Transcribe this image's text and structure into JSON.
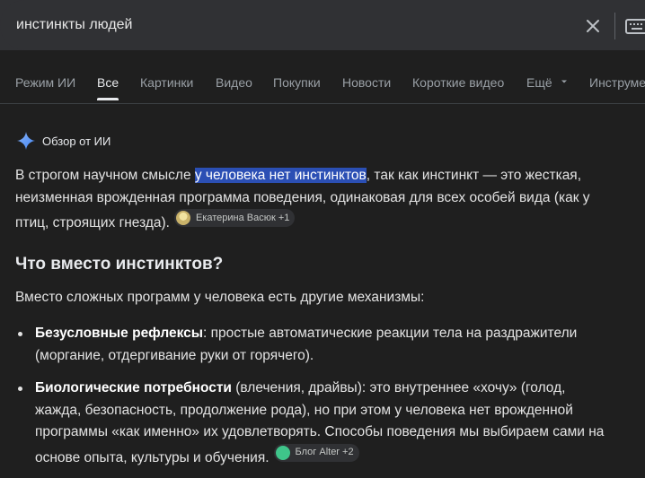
{
  "search": {
    "query": "инстинкты людей"
  },
  "tabs": [
    {
      "label": "Режим ИИ"
    },
    {
      "label": "Все"
    },
    {
      "label": "Картинки"
    },
    {
      "label": "Видео"
    },
    {
      "label": "Покупки"
    },
    {
      "label": "Новости"
    },
    {
      "label": "Короткие видео"
    },
    {
      "label": "Ещё"
    },
    {
      "label": "Инструменты"
    }
  ],
  "overview": {
    "title": "Обзор от ИИ",
    "intro_before": "В строгом научном смысле ",
    "intro_highlight": "у человека нет инстинктов",
    "intro_after": ", так как инстинкт — это жесткая, неизменная врожденная программа поведения, одинаковая для всех особей вида (как у птиц, строящих гнезда).",
    "chip1": "Екатерина Васюк +1",
    "heading": "Что вместо инстинктов?",
    "lead": "Вместо сложных программ у человека есть другие механизмы:",
    "bullet1_bold": "Безусловные рефлексы",
    "bullet1_text": ": простые автоматические реакции тела на раздражители (моргание, отдергивание руки от горячего).",
    "bullet2_bold": "Биологические потребности",
    "bullet2_text": " (влечения, драйвы): это внутреннее «хочу» (голод, жажда, безопасность, продолжение рода), но при этом у человека нет врожденной программы «как именно» их удовлетворять. Способы поведения мы выбираем сами на основе опыта, культуры и обучения.",
    "chip2": "Блог Alter +2"
  },
  "colors": {
    "background": "#1f1f1f",
    "highlight": "#2b4fb4",
    "sparkle": "#8ab4f8"
  }
}
